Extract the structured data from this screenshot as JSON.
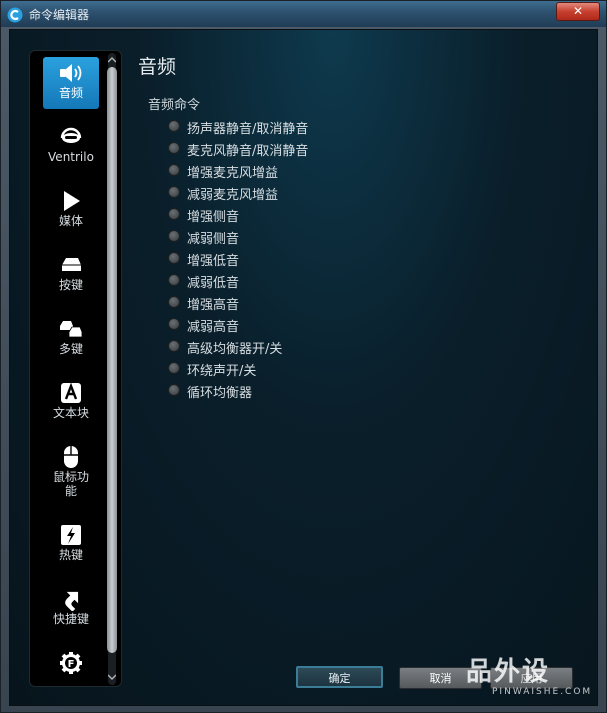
{
  "window": {
    "title": "命令编辑器",
    "close_label": "✕"
  },
  "sidebar": {
    "items": [
      {
        "label": "音频",
        "icon": "speaker-icon",
        "active": true
      },
      {
        "label": "Ventrilo",
        "icon": "headset-icon",
        "active": false
      },
      {
        "label": "媒体",
        "icon": "play-icon",
        "active": false
      },
      {
        "label": "按键",
        "icon": "key-icon",
        "active": false
      },
      {
        "label": "多键",
        "icon": "multikey-icon",
        "active": false
      },
      {
        "label": "文本块",
        "icon": "text-block-icon",
        "active": false
      },
      {
        "label": "鼠标功能",
        "icon": "mouse-icon",
        "active": false
      },
      {
        "label": "热键",
        "icon": "hotkey-icon",
        "active": false
      },
      {
        "label": "快捷键",
        "icon": "shortcut-arrow-icon",
        "active": false
      },
      {
        "label": "",
        "icon": "function-gear-icon",
        "active": false
      }
    ]
  },
  "main": {
    "page_title": "音频",
    "section_title": "音频命令",
    "options": [
      "扬声器静音/取消静音",
      "麦克风静音/取消静音",
      "增强麦克风增益",
      "减弱麦克风增益",
      "增强侧音",
      "减弱侧音",
      "增强低音",
      "减弱低音",
      "增强高音",
      "减弱高音",
      "高级均衡器开/关",
      "环绕声开/关",
      "循环均衡器"
    ]
  },
  "footer": {
    "ok_label": "确定",
    "cancel_label": "取消",
    "apply_label": "应用"
  },
  "watermark": {
    "main": "品外设",
    "sub": "PINWAISHE.COM"
  },
  "colors": {
    "accent": "#1f8fd0",
    "background": "#07141c"
  }
}
